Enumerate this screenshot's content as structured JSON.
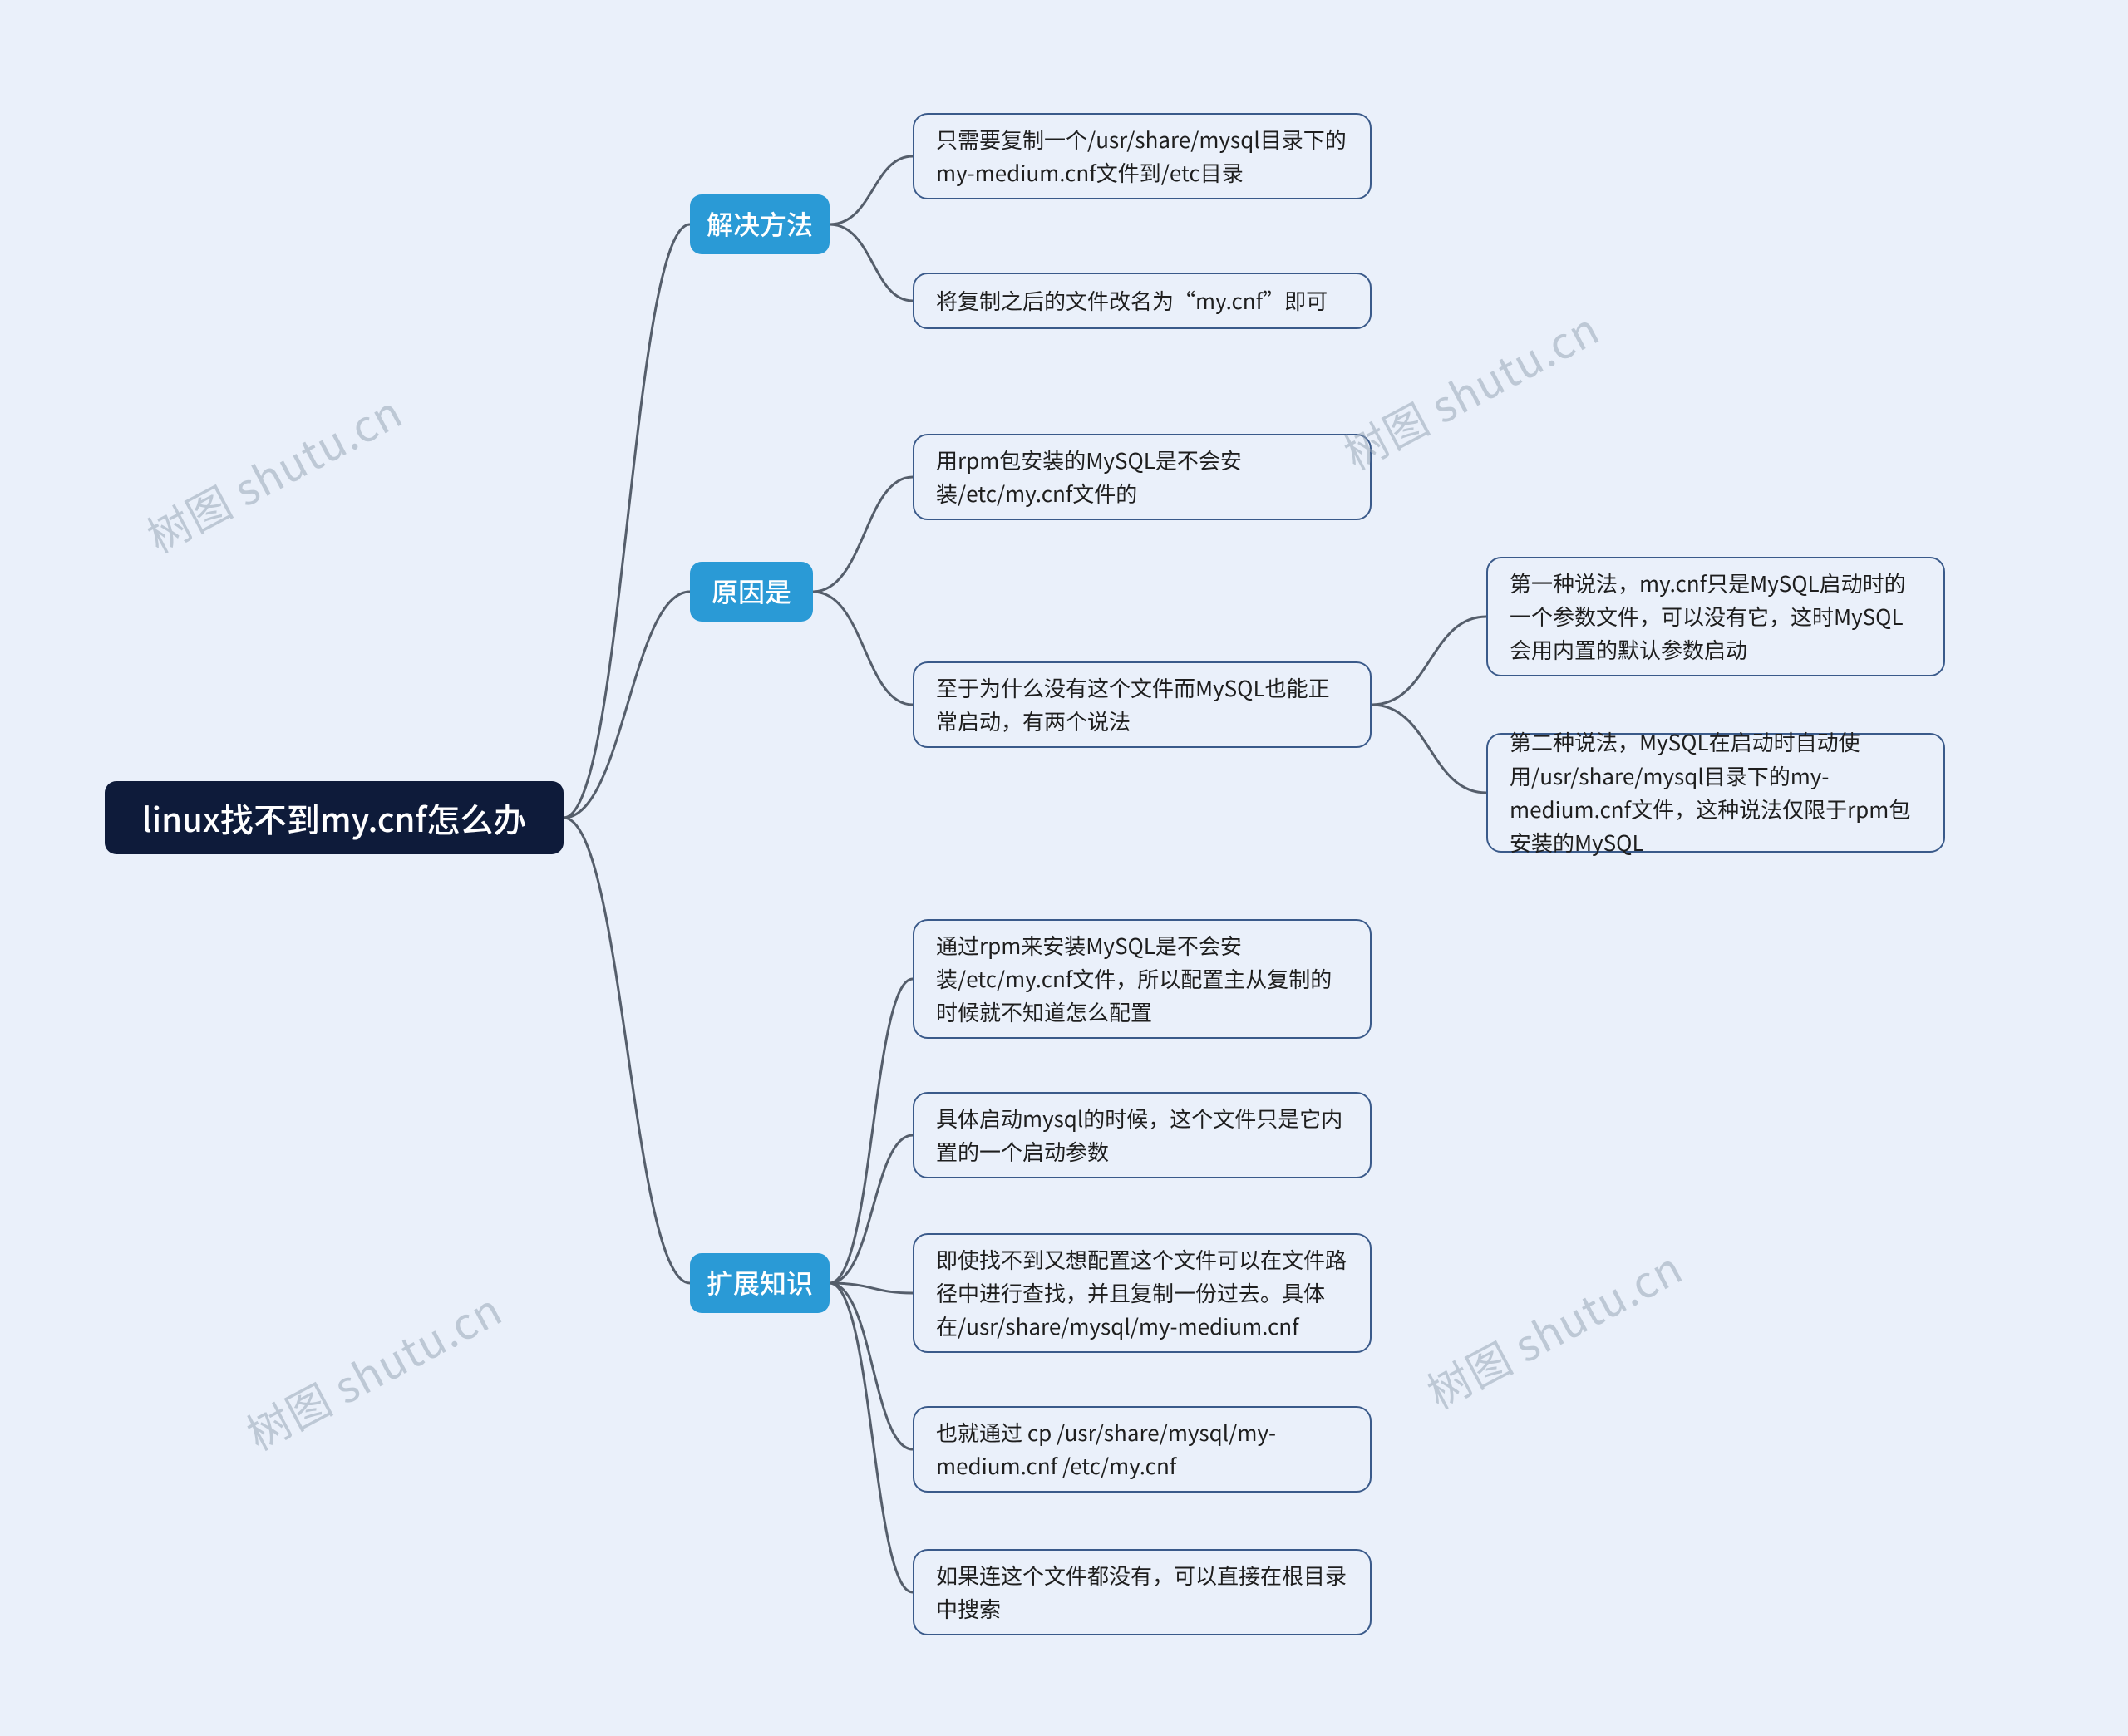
{
  "root": {
    "label": "linux找不到my.cnf怎么办"
  },
  "branches": {
    "solution": {
      "label": "解决方法"
    },
    "reason": {
      "label": "原因是"
    },
    "extend": {
      "label": "扩展知识"
    }
  },
  "leaves": {
    "sol1": "只需要复制一个/usr/share/mysql目录下的my-medium.cnf文件到/etc目录",
    "sol2": "将复制之后的文件改名为“my.cnf”即可",
    "rsn1": "用rpm包安装的MySQL是不会安装/etc/my.cnf文件的",
    "rsn2": "至于为什么没有这个文件而MySQL也能正常启动，有两个说法",
    "rsn2a": "第一种说法，my.cnf只是MySQL启动时的一个参数文件，可以没有它，这时MySQL会用内置的默认参数启动",
    "rsn2b": "第二种说法，MySQL在启动时自动使用/usr/share/mysql目录下的my-medium.cnf文件，这种说法仅限于rpm包安装的MySQL",
    "ext1": "通过rpm来安装MySQL是不会安装/etc/my.cnf文件，所以配置主从复制的时候就不知道怎么配置",
    "ext2": "具体启动mysql的时候，这个文件只是它内置的一个启动参数",
    "ext3": "即使找不到又想配置这个文件可以在文件路径中进行查找，并且复制一份过去。具体在/usr/share/mysql/my-medium.cnf",
    "ext4": "也就通过 cp /usr/share/mysql/my-medium.cnf /etc/my.cnf",
    "ext5": "如果连这个文件都没有，可以直接在根目录中搜索"
  },
  "watermark": "树图 shutu.cn"
}
